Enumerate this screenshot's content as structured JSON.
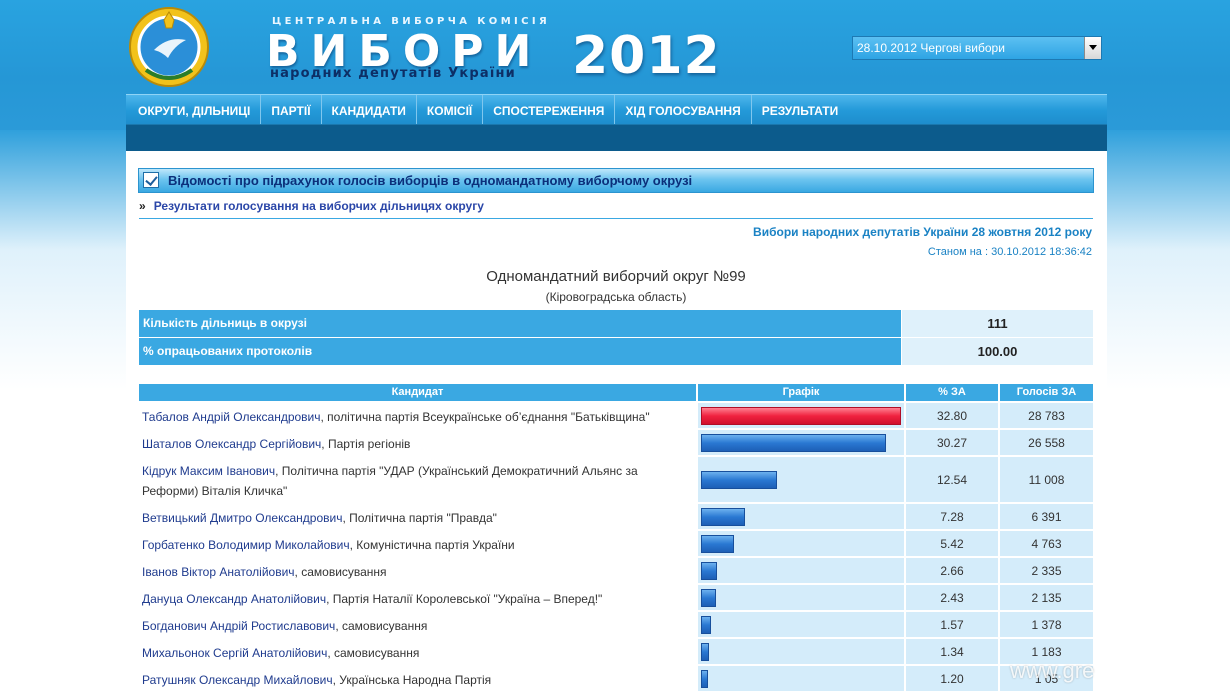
{
  "header": {
    "commission": "ЦЕНТРАЛЬНА ВИБОРЧА КОМІСІЯ",
    "title": "ВИБОРИ",
    "subtitle": "народних депутатів України",
    "year": "2012",
    "election_select": "28.10.2012 Чергові вибори"
  },
  "nav": {
    "items": [
      "ОКРУГИ, ДІЛЬНИЦІ",
      "ПАРТІЇ",
      "КАНДИДАТИ",
      "КОМІСІЇ",
      "СПОСТЕРЕЖЕННЯ",
      "ХІД ГОЛОСУВАННЯ",
      "РЕЗУЛЬТАТИ"
    ]
  },
  "section": {
    "title": "Відомості про підрахунок голосів виборців в одномандатному виборчому окрузі",
    "crumb_marker": "»",
    "crumb_link": "Результати голосування на виборчих дільницях округу",
    "election_name": "Вибори народних депутатів України 28 жовтня 2012 року",
    "as_of": "Станом на : 30.10.2012 18:36:42",
    "district_title": "Одномандатний виборчий округ №99",
    "district_region": "(Кіровоградська область)"
  },
  "summary": [
    {
      "label": "Кількість дільниць в окрузі",
      "value": "111"
    },
    {
      "label": "% опрацьованих протоколів",
      "value": "100.00"
    }
  ],
  "results": {
    "headers": {
      "candidate": "Кандидат",
      "graph": "Графік",
      "pct": "% ЗА",
      "votes": "Голосів ЗА"
    },
    "max_pct": 32.8,
    "rows": [
      {
        "name": "Табалов Андрій Олександрович",
        "party": ", політична партія Всеукраїнське об’єднання \"Батьківщина\"",
        "pct": "32.80",
        "votes": "28 783",
        "lead": true
      },
      {
        "name": "Шаталов Олександр Сергійович",
        "party": ", Партія регіонів",
        "pct": "30.27",
        "votes": "26 558",
        "lead": false
      },
      {
        "name": "Кідрук Максим Іванович",
        "party": ", Політична партія \"УДАР (Український Демократичний Альянс за Реформи) Віталія Кличка\"",
        "pct": "12.54",
        "votes": "11 008",
        "lead": false
      },
      {
        "name": "Ветвицький Дмитро Олександрович",
        "party": ", Політична партія \"Правда\"",
        "pct": "7.28",
        "votes": "6 391",
        "lead": false
      },
      {
        "name": "Горбатенко Володимир Миколайович",
        "party": ", Комуністична партія України",
        "pct": "5.42",
        "votes": "4 763",
        "lead": false
      },
      {
        "name": "Іванов Віктор Анатолійович",
        "party": ", самовисування",
        "pct": "2.66",
        "votes": "2 335",
        "lead": false
      },
      {
        "name": "Дануца Олександр Анатолійович",
        "party": ", Партія Наталії Королевської \"Україна – Вперед!\"",
        "pct": "2.43",
        "votes": "2 135",
        "lead": false
      },
      {
        "name": "Богданович Андрій Ростиславович",
        "party": ", самовисування",
        "pct": "1.57",
        "votes": "1 378",
        "lead": false
      },
      {
        "name": "Михальонок Сергій Анатолійович",
        "party": ", самовисування",
        "pct": "1.34",
        "votes": "1 183",
        "lead": false
      },
      {
        "name": "Ратушняк Олександр Михайлович",
        "party": ", Українська Народна Партія",
        "pct": "1.20",
        "votes": "1 05",
        "lead": false
      }
    ]
  },
  "watermark": "www.gre"
}
